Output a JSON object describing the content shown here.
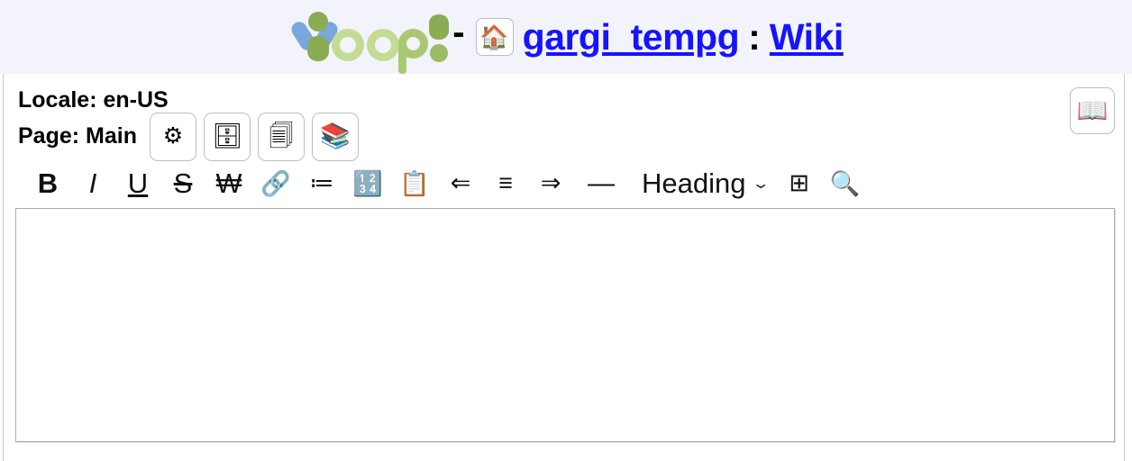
{
  "header": {
    "logo_alt": "Yoop",
    "logo_text": "Yoop!",
    "separator": "-",
    "home_icon": "🏠",
    "title_primary": "gargi_tempg",
    "title_colon": ":",
    "title_secondary": "Wiki",
    "link_color": "#1414ff",
    "band_color": "#f3f3fb"
  },
  "meta": {
    "locale_line": "Locale: en-US",
    "page_line": "Page: Main",
    "buttons": [
      {
        "name": "settings",
        "icon": "⚙"
      },
      {
        "name": "file-cabinet",
        "icon": "🗄"
      },
      {
        "name": "page-copy",
        "icon": "🗐"
      },
      {
        "name": "books",
        "icon": "📚"
      }
    ],
    "book_button": {
      "name": "open-book",
      "icon": "📖"
    }
  },
  "toolbar": {
    "items": [
      {
        "name": "bold",
        "label": "B"
      },
      {
        "name": "italic",
        "label": "I"
      },
      {
        "name": "underline",
        "label": "U"
      },
      {
        "name": "strikethrough",
        "label": "S"
      },
      {
        "name": "won-sign",
        "label": "₩"
      },
      {
        "name": "link",
        "label": "🔗"
      },
      {
        "name": "bullet-list",
        "label": "≔"
      },
      {
        "name": "numbered-list",
        "label": "🔢"
      },
      {
        "name": "clipboard",
        "label": "📋"
      },
      {
        "name": "align-left",
        "label": "⇐"
      },
      {
        "name": "align-center",
        "label": "≡"
      },
      {
        "name": "align-right",
        "label": "⇒"
      },
      {
        "name": "horizontal-rule",
        "label": "—"
      }
    ],
    "heading": {
      "label": "Heading",
      "chevron": "⌄"
    },
    "table": {
      "name": "table",
      "label": "⊞"
    },
    "search": {
      "name": "search",
      "label": "🔍"
    }
  },
  "editor": {
    "content": "",
    "placeholder": ""
  }
}
